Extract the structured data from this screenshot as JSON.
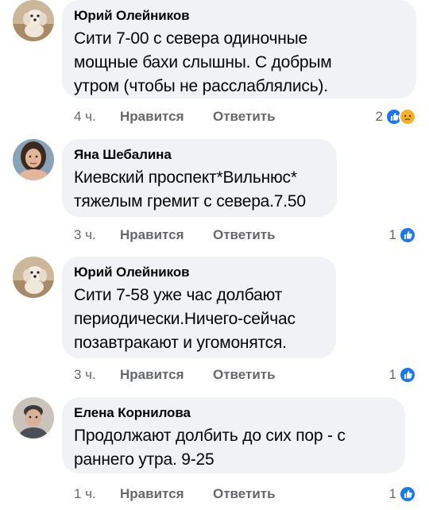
{
  "comments": [
    {
      "author": "Юрий Олейников",
      "text_lines": [
        "Сити 7-00 с севера одиночные",
        "мощные бахи слышны. С добрым",
        "утром (чтобы не расслаблялись)."
      ],
      "time": "4 ч.",
      "like_label": "Нравится",
      "reply_label": "Ответить",
      "reaction_count": "2",
      "reactions": [
        "like-icon",
        "sad-icon"
      ],
      "avatar": "dog-avatar"
    },
    {
      "author": "Яна Шебалина",
      "text_lines": [
        "Киевский проспект*Вильнюс*",
        "тяжелым гремит с севера.7.50"
      ],
      "time": "3 ч.",
      "like_label": "Нравится",
      "reply_label": "Ответить",
      "reaction_count": "1",
      "reactions": [
        "like-icon"
      ],
      "avatar": "woman-avatar"
    },
    {
      "author": "Юрий Олейников",
      "text_lines": [
        "Сити 7-58 уже час долбают",
        "периодически.Ничего-сейчас",
        "позавтракают  и угомонятся."
      ],
      "time": "3 ч.",
      "like_label": "Нравится",
      "reply_label": "Ответить",
      "reaction_count": "1",
      "reactions": [
        "like-icon"
      ],
      "avatar": "dog-avatar"
    },
    {
      "author": "Елена Корнилова",
      "text_lines": [
        "Продолжают долбить до сих пор - с",
        "раннего утра. 9-25"
      ],
      "time": "1 ч.",
      "like_label": "Нравится",
      "reply_label": "Ответить",
      "reaction_count": "1",
      "reactions": [
        "like-icon"
      ],
      "avatar": "woman-avatar"
    }
  ],
  "colors": {
    "bubble": "#f0f2f5",
    "meta_text": "#65676b",
    "like_blue": "#1877f2",
    "sad_yellow": "#f7b125"
  }
}
